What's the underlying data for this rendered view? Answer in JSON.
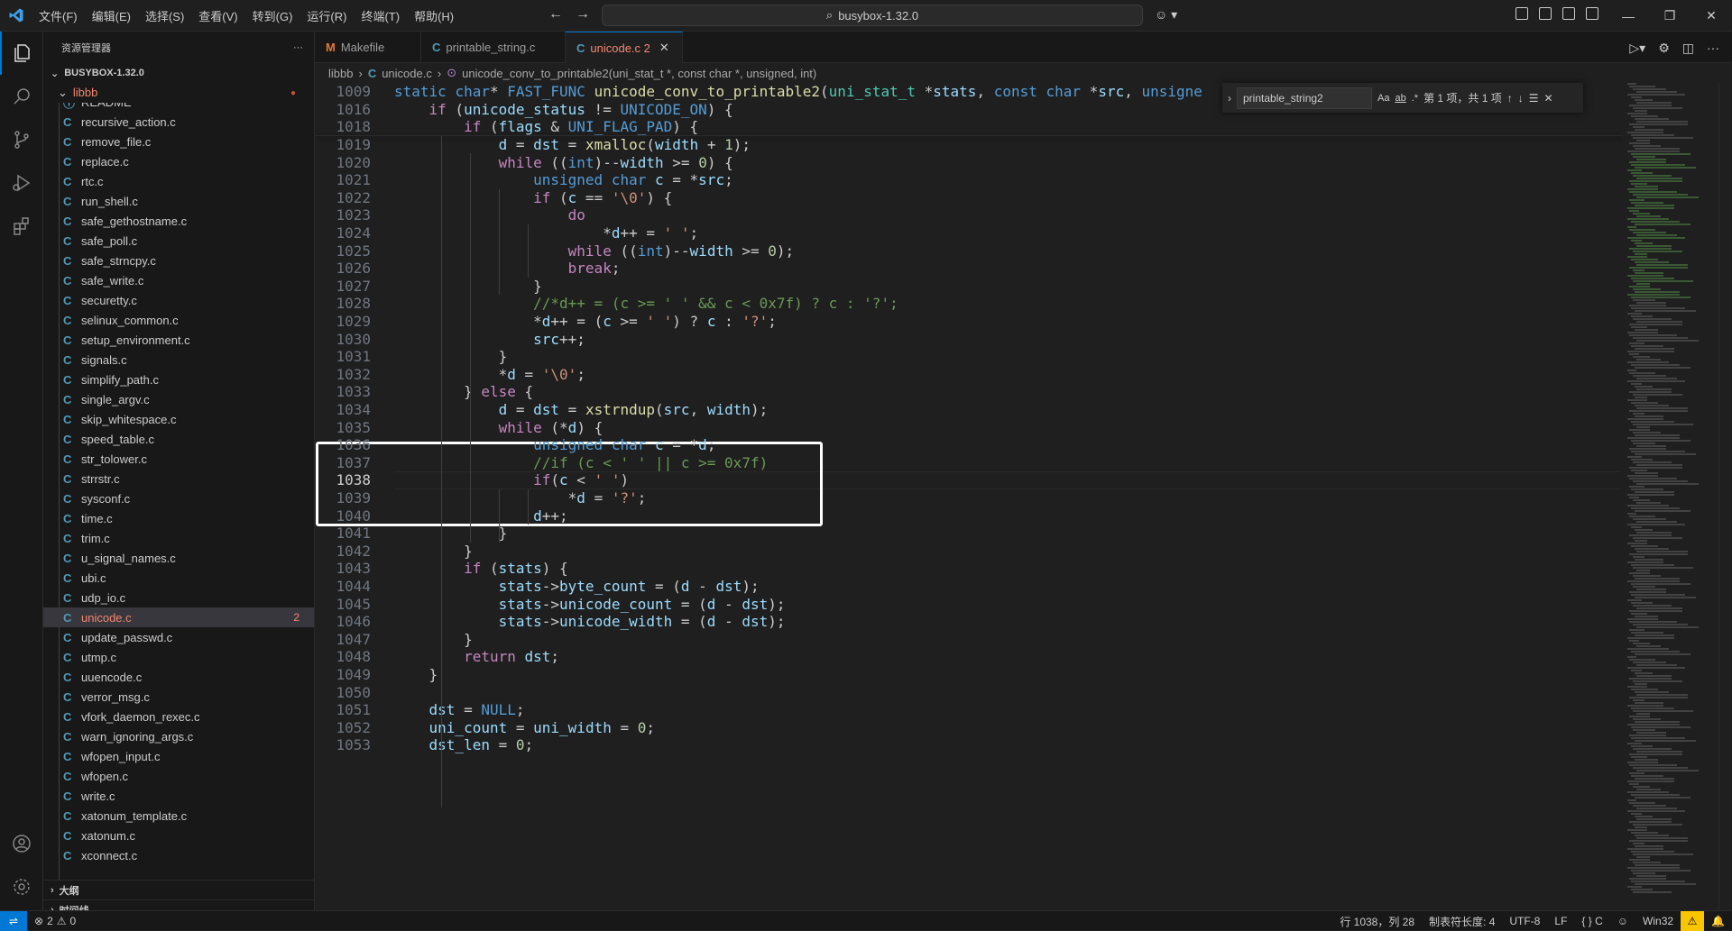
{
  "titlebar": {
    "menu": [
      "文件(F)",
      "编辑(E)",
      "选择(S)",
      "查看(V)",
      "转到(G)",
      "运行(R)",
      "终端(T)",
      "帮助(H)"
    ],
    "search_text": "busybox-1.32.0"
  },
  "sidebar": {
    "header": "资源管理器",
    "root": "BUSYBOX-1.32.0",
    "subfolder": "libbb",
    "files": [
      "README",
      "recursive_action.c",
      "remove_file.c",
      "replace.c",
      "rtc.c",
      "run_shell.c",
      "safe_gethostname.c",
      "safe_poll.c",
      "safe_strncpy.c",
      "safe_write.c",
      "securetty.c",
      "selinux_common.c",
      "setup_environment.c",
      "signals.c",
      "simplify_path.c",
      "single_argv.c",
      "skip_whitespace.c",
      "speed_table.c",
      "str_tolower.c",
      "strrstr.c",
      "sysconf.c",
      "time.c",
      "trim.c",
      "u_signal_names.c",
      "ubi.c",
      "udp_io.c",
      "unicode.c",
      "update_passwd.c",
      "utmp.c",
      "uuencode.c",
      "verror_msg.c",
      "vfork_daemon_rexec.c",
      "warn_ignoring_args.c",
      "wfopen_input.c",
      "wfopen.c",
      "write.c",
      "xatonum_template.c",
      "xatonum.c",
      "xconnect.c"
    ],
    "selected_file": "unicode.c",
    "selected_count": "2",
    "outline_label": "大纲",
    "timeline_label": "时间线"
  },
  "tabs": [
    {
      "icon": "M",
      "label": "Makefile"
    },
    {
      "icon": "C",
      "label": "printable_string.c"
    },
    {
      "icon": "C",
      "label": "unicode.c 2"
    }
  ],
  "breadcrumb": {
    "folder": "libbb",
    "file": "unicode.c",
    "symbol": "unicode_conv_to_printable2(uni_stat_t *, const char *, unsigned, int)"
  },
  "find": {
    "query": "printable_string2",
    "opt_case": "Aa",
    "opt_word": "ab",
    "opt_regex": ".*",
    "result": "第 1 项，共 1 项"
  },
  "editor": {
    "current_line": "1038",
    "lines": [
      {
        "n": "1009",
        "html": "<span class=\"kw\">static</span> <span class=\"kw\">char</span>* <span class=\"mac\">FAST_FUNC</span> <span class=\"fn\">unicode_conv_to_printable2</span>(<span class=\"ty\">uni_stat_t</span> *<span class=\"var\">stats</span>, <span class=\"kw\">const</span> <span class=\"kw\">char</span> *<span class=\"var\">src</span>, <span class=\"kw\">unsigne</span>"
      },
      {
        "n": "1016",
        "html": "    <span class=\"kw2\">if</span> (<span class=\"var\">unicode_status</span> != <span class=\"mac\">UNICODE_ON</span>) {"
      },
      {
        "n": "1018",
        "html": "        <span class=\"kw2\">if</span> (<span class=\"var\">flags</span> &amp; <span class=\"mac\">UNI_FLAG_PAD</span>) {"
      },
      {
        "n": "1019",
        "html": "            <span class=\"var\">d</span> = <span class=\"var\">dst</span> = <span class=\"fn\">xmalloc</span>(<span class=\"var\">width</span> + <span class=\"num\">1</span>);"
      },
      {
        "n": "1020",
        "html": "            <span class=\"kw2\">while</span> ((<span class=\"kw\">int</span>)--<span class=\"var\">width</span> &gt;= <span class=\"num\">0</span>) {"
      },
      {
        "n": "1021",
        "html": "                <span class=\"kw\">unsigned</span> <span class=\"kw\">char</span> <span class=\"var\">c</span> = *<span class=\"var\">src</span>;"
      },
      {
        "n": "1022",
        "html": "                <span class=\"kw2\">if</span> (<span class=\"var\">c</span> == <span class=\"str\">'\\0'</span>) {"
      },
      {
        "n": "1023",
        "html": "                    <span class=\"kw2\">do</span>"
      },
      {
        "n": "1024",
        "html": "                        *<span class=\"var\">d</span>++ = <span class=\"str\">' '</span>;"
      },
      {
        "n": "1025",
        "html": "                    <span class=\"kw2\">while</span> ((<span class=\"kw\">int</span>)--<span class=\"var\">width</span> &gt;= <span class=\"num\">0</span>);"
      },
      {
        "n": "1026",
        "html": "                    <span class=\"kw2\">break</span>;"
      },
      {
        "n": "1027",
        "html": "                }"
      },
      {
        "n": "1028",
        "html": "                <span class=\"cm\">//*d++ = (c &gt;= ' ' &amp;&amp; c &lt; 0x7f) ? c : '?';</span>"
      },
      {
        "n": "1029",
        "html": "                *<span class=\"var\">d</span>++ = (<span class=\"var\">c</span> &gt;= <span class=\"str\">' '</span>) ? <span class=\"var\">c</span> : <span class=\"str\">'?'</span>;"
      },
      {
        "n": "1030",
        "html": "                <span class=\"var\">src</span>++;"
      },
      {
        "n": "1031",
        "html": "            }"
      },
      {
        "n": "1032",
        "html": "            *<span class=\"var\">d</span> = <span class=\"str\">'\\0'</span>;"
      },
      {
        "n": "1033",
        "html": "        } <span class=\"kw2\">else</span> {"
      },
      {
        "n": "1034",
        "html": "            <span class=\"var\">d</span> = <span class=\"var\">dst</span> = <span class=\"fn\">xstrndup</span>(<span class=\"var\">src</span>, <span class=\"var\">width</span>);"
      },
      {
        "n": "1035",
        "html": "            <span class=\"kw2\">while</span> (*<span class=\"var\">d</span>) {"
      },
      {
        "n": "1036",
        "html": "                <span class=\"kw\">unsigned</span> <span class=\"kw\">char</span> <span class=\"var\">c</span> = *<span class=\"var\">d</span>;"
      },
      {
        "n": "1037",
        "html": "                <span class=\"cm\">//if (c &lt; ' ' || c &gt;= 0x7f)</span>"
      },
      {
        "n": "1038",
        "html": "                <span class=\"kw2\">if</span>(<span class=\"var\">c</span> &lt; <span class=\"str\">' '</span>)"
      },
      {
        "n": "1039",
        "html": "                    *<span class=\"var\">d</span> = <span class=\"str\">'?'</span>;"
      },
      {
        "n": "1040",
        "html": "                <span class=\"var\">d</span>++;"
      },
      {
        "n": "1041",
        "html": "            }"
      },
      {
        "n": "1042",
        "html": "        }"
      },
      {
        "n": "1043",
        "html": "        <span class=\"kw2\">if</span> (<span class=\"var\">stats</span>) {"
      },
      {
        "n": "1044",
        "html": "            <span class=\"var\">stats</span>-&gt;<span class=\"var\">byte_count</span> = (<span class=\"var\">d</span> - <span class=\"var\">dst</span>);"
      },
      {
        "n": "1045",
        "html": "            <span class=\"var\">stats</span>-&gt;<span class=\"var\">unicode_count</span> = (<span class=\"var\">d</span> - <span class=\"var\">dst</span>);"
      },
      {
        "n": "1046",
        "html": "            <span class=\"var\">stats</span>-&gt;<span class=\"var\">unicode_width</span> = (<span class=\"var\">d</span> - <span class=\"var\">dst</span>);"
      },
      {
        "n": "1047",
        "html": "        }"
      },
      {
        "n": "1048",
        "html": "        <span class=\"kw2\">return</span> <span class=\"var\">dst</span>;"
      },
      {
        "n": "1049",
        "html": "    }"
      },
      {
        "n": "1050",
        "html": ""
      },
      {
        "n": "1051",
        "html": "    <span class=\"var\">dst</span> = <span class=\"mac\">NULL</span>;"
      },
      {
        "n": "1052",
        "html": "    <span class=\"var\">uni_count</span> = <span class=\"var\">uni_width</span> = <span class=\"num\">0</span>;"
      },
      {
        "n": "1053",
        "html": "    <span class=\"var\">dst_len</span> = <span class=\"num\">0</span>;"
      }
    ]
  },
  "status": {
    "errors": "2",
    "warnings": "0",
    "position": "行 1038，列 28",
    "indent": "制表符长度: 4",
    "encoding": "UTF-8",
    "eol": "LF",
    "language": "{ } C",
    "platform": "Win32"
  }
}
